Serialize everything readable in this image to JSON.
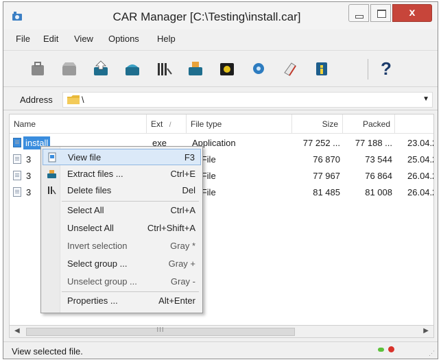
{
  "window": {
    "title": "CAR Manager [C:\\Testing\\install.car]",
    "close_symbol": "x"
  },
  "menubar": [
    "File",
    "Edit",
    "View",
    "Options",
    "Help"
  ],
  "toolbar": {
    "icons": [
      "briefcase-icon",
      "open-case-icon",
      "extract-icon",
      "add-files-icon",
      "delete-files-icon",
      "test-icon",
      "virus-check-icon",
      "view-disc-icon",
      "eraser-icon",
      "info-icon"
    ],
    "help_label": "?"
  },
  "address": {
    "label": "Address",
    "value": "\\"
  },
  "columns": [
    "Name",
    "Ext",
    "File type",
    "Size",
    "Packed"
  ],
  "sort_indicator": "/",
  "rows": [
    {
      "name": "install",
      "ext": "exe",
      "type": "Application",
      "size": "77 252 ...",
      "packed": "77 188 ...",
      "date": "23.04.2"
    },
    {
      "name": "3",
      "ext": "",
      "type": "G File",
      "size": "76 870",
      "packed": "73 544",
      "date": "25.04.2"
    },
    {
      "name": "3",
      "ext": "",
      "type": "G File",
      "size": "77 967",
      "packed": "76 864",
      "date": "26.04.2"
    },
    {
      "name": "3",
      "ext": "",
      "type": "G File",
      "size": "81 485",
      "packed": "81 008",
      "date": "26.04.2"
    }
  ],
  "context_menu": {
    "items": [
      {
        "label": "View file",
        "shortcut": "F3",
        "icon": "view-file-icon"
      },
      {
        "label": "Extract files ...",
        "shortcut": "Ctrl+E",
        "icon": "extract-files-icon"
      },
      {
        "label": "Delete files",
        "shortcut": "Del",
        "icon": "delete-files-icon"
      },
      {
        "label": "Select All",
        "shortcut": "Ctrl+A"
      },
      {
        "label": "Unselect All",
        "shortcut": "Ctrl+Shift+A"
      },
      {
        "label": "Invert selection",
        "shortcut": "Gray *"
      },
      {
        "label": "Select group ...",
        "shortcut": "Gray +"
      },
      {
        "label": "Unselect group ...",
        "shortcut": "Gray -"
      },
      {
        "label": "Properties ...",
        "shortcut": "Alt+Enter"
      }
    ]
  },
  "scrollbar": {
    "thumb_grip": "III"
  },
  "status": {
    "text": "View selected file."
  },
  "colors": {
    "selection": "#3a8dde",
    "close_button": "#c7453a",
    "menu_highlight": "#dbe9f8"
  }
}
